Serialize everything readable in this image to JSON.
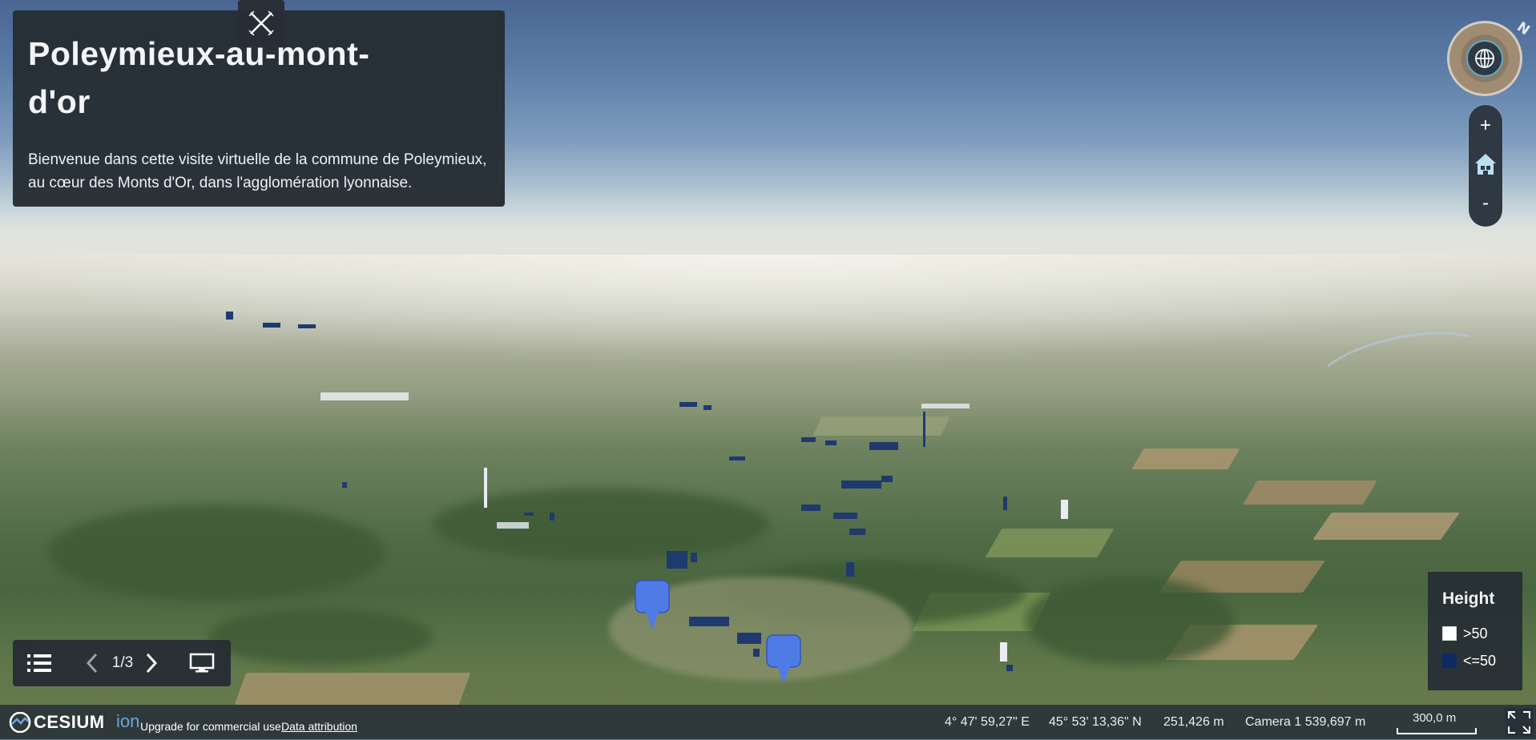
{
  "story": {
    "title": "Poleymieux-au-mont-d'or",
    "description": "Bienvenue dans cette visite virtuelle de la commune de Poleymieux, au cœur des Monts d'Or, dans l'agglomération lyonnaise."
  },
  "navigation": {
    "compass_letter": "N",
    "zoom_in_label": "+",
    "zoom_out_label": "-",
    "icons": [
      "globe-icon",
      "home-icon"
    ]
  },
  "legend": {
    "title": "Height",
    "items": [
      {
        "label": ">50",
        "color": "#ffffff"
      },
      {
        "label": "<=50",
        "color": "#0d2b63"
      }
    ]
  },
  "tour": {
    "page_indicator": "1/3",
    "icons": [
      "list-icon",
      "chevron-left-icon",
      "chevron-right-icon",
      "monitor-icon",
      "close-icon"
    ]
  },
  "status": {
    "logo": "CESIUM",
    "logo_suffix": "ion",
    "upgrade_text": "Upgrade for commercial use.",
    "attribution_link": "Data attribution",
    "longitude": "4° 47' 59,27\" E",
    "latitude": "45° 53' 13,36\" N",
    "elevation": "251,426 m",
    "camera": "Camera 1 539,697 m",
    "scale": "300,0 m"
  },
  "colors": {
    "panel_bg": "#262d34",
    "marker": "#4f7be6",
    "building_low": "#1f3a6e",
    "building_high": "#e9edf2"
  }
}
